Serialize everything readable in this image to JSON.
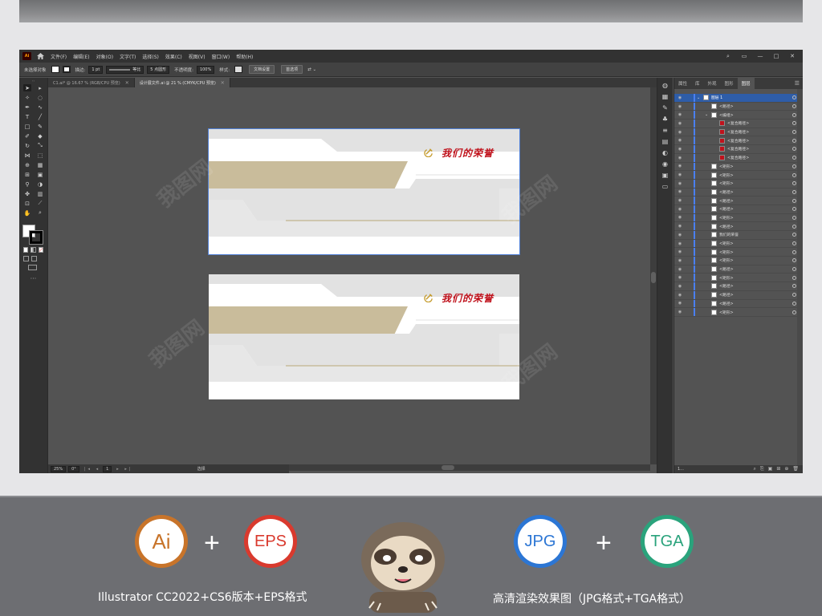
{
  "menu": {
    "app_badge": "Ai",
    "items": [
      "文件(F)",
      "编辑(E)",
      "对象(O)",
      "文字(T)",
      "选择(S)",
      "效果(C)",
      "视图(V)",
      "窗口(W)",
      "帮助(H)"
    ]
  },
  "controlbar": {
    "selection_label": "未选择对象",
    "stroke_label": "描边:",
    "stroke_value": "1 pt",
    "stroke_style": "等比",
    "brush_value": "5 点圆形",
    "opacity_label": "不透明度:",
    "opacity_value": "100%",
    "style_label": "样式:",
    "doc_setup_button": "文档设置",
    "preferences_button": "首选项"
  },
  "tabs": [
    {
      "label": "C1.ai* @ 16.67 % (RGB/CPU 预览)",
      "active": false
    },
    {
      "label": "设计展文件.ai @ 21 % (CMYK/CPU 预览)",
      "active": true
    }
  ],
  "artboards": [
    {
      "title": "我们的荣誉"
    },
    {
      "title": "我们的荣誉"
    }
  ],
  "statusbar": {
    "zoom": "25%",
    "angle": "0°",
    "artboard_index": "1",
    "tool_name": "选择"
  },
  "panel": {
    "tabs": [
      "属性",
      "库",
      "外观",
      "图形",
      "图层"
    ],
    "active_tab": "图层",
    "layers": [
      {
        "name": "图层 1",
        "indent": 0,
        "top": true,
        "caret": "⌄"
      },
      {
        "name": "<路径>",
        "indent": 1
      },
      {
        "name": "<编组>",
        "indent": 1,
        "caret": "⌄"
      },
      {
        "name": "<复合路径>",
        "indent": 2,
        "red": true
      },
      {
        "name": "<复合路径>",
        "indent": 2,
        "red": true
      },
      {
        "name": "<复合路径>",
        "indent": 2,
        "red": true
      },
      {
        "name": "<复合路径>",
        "indent": 2,
        "red": true
      },
      {
        "name": "<复合路径>",
        "indent": 2,
        "red": true
      },
      {
        "name": "<矩形>",
        "indent": 1
      },
      {
        "name": "<矩形>",
        "indent": 1
      },
      {
        "name": "<矩形>",
        "indent": 1
      },
      {
        "name": "<路径>",
        "indent": 1
      },
      {
        "name": "<路径>",
        "indent": 1
      },
      {
        "name": "<路径>",
        "indent": 1
      },
      {
        "name": "<矩形>",
        "indent": 1
      },
      {
        "name": "<路径>",
        "indent": 1
      },
      {
        "name": "我们的荣誉",
        "indent": 1
      },
      {
        "name": "<矩形>",
        "indent": 1
      },
      {
        "name": "<矩形>",
        "indent": 1
      },
      {
        "name": "<矩形>",
        "indent": 1
      },
      {
        "name": "<路径>",
        "indent": 1
      },
      {
        "name": "<矩形>",
        "indent": 1
      },
      {
        "name": "<路径>",
        "indent": 1
      },
      {
        "name": "<路径>",
        "indent": 1
      },
      {
        "name": "<路径>",
        "indent": 1
      },
      {
        "name": "<矩形>",
        "indent": 1
      }
    ],
    "footer_label": "1..."
  },
  "promo": {
    "badges": [
      {
        "text": "Ai",
        "color": "#c8742a"
      },
      {
        "text": "EPS",
        "color": "#d93a2e"
      },
      {
        "text": "JPG",
        "color": "#2c76d4"
      },
      {
        "text": "TGA",
        "color": "#2aa37c"
      }
    ],
    "plus": "+",
    "left_caption": "Illustrator CC2022+CS6版本+EPS格式",
    "right_caption": "高清渲染效果图（JPG格式+TGA格式）"
  },
  "colors": {
    "accent_blue": "#2e5da8",
    "title_red": "#c0121c",
    "tan": "#c9bc9b",
    "grey_shape": "#e2e2e2"
  }
}
